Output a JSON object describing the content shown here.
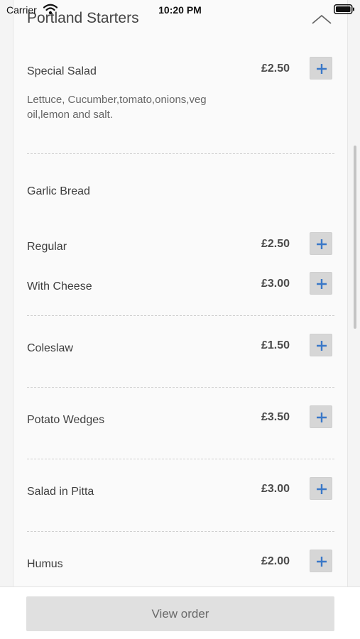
{
  "status_bar": {
    "carrier": "Carrier",
    "time": "10:20 PM"
  },
  "section": {
    "title": "Portland Starters",
    "collapse_icon": "chevron-up-icon"
  },
  "items": [
    {
      "name": "Special Salad",
      "price": "£2.50",
      "description": "Lettuce, Cucumber,tomato,onions,veg oil,lemon and salt."
    },
    {
      "name": "Garlic Bread"
    },
    {
      "name": "Regular",
      "price": "£2.50"
    },
    {
      "name": "With Cheese",
      "price": "£3.00"
    },
    {
      "name": "Coleslaw",
      "price": "£1.50"
    },
    {
      "name": "Potato Wedges",
      "price": "£3.50"
    },
    {
      "name": "Salad in Pitta",
      "price": "£3.00"
    },
    {
      "name": "Humus",
      "price": "£2.00"
    }
  ],
  "icons": {
    "add": "plus-icon",
    "wifi": "wifi-icon",
    "battery": "battery-icon"
  },
  "colors": {
    "accent": "#3a78c8",
    "button_bg": "#d6d6d6",
    "view_order_bg": "#e0e0e0"
  },
  "footer": {
    "view_order_label": "View order"
  }
}
